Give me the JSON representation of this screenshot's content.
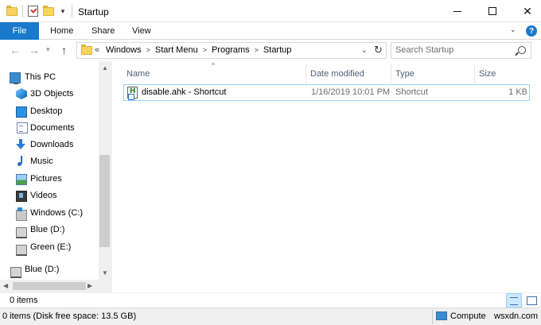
{
  "window": {
    "title": "Startup"
  },
  "ribbon": {
    "tabs": [
      "File",
      "Home",
      "Share",
      "View"
    ]
  },
  "address": {
    "overflow": "«",
    "crumbs": [
      "Windows",
      "Start Menu",
      "Programs",
      "Startup"
    ]
  },
  "search": {
    "placeholder": "Search Startup"
  },
  "sidebar": {
    "items": [
      {
        "label": "This PC",
        "icon": "this-pc-icon"
      },
      {
        "label": "3D Objects",
        "icon": "3d-objects-icon"
      },
      {
        "label": "Desktop",
        "icon": "desktop-icon"
      },
      {
        "label": "Documents",
        "icon": "documents-icon"
      },
      {
        "label": "Downloads",
        "icon": "downloads-icon"
      },
      {
        "label": "Music",
        "icon": "music-icon"
      },
      {
        "label": "Pictures",
        "icon": "pictures-icon"
      },
      {
        "label": "Videos",
        "icon": "videos-icon"
      },
      {
        "label": "Windows (C:)",
        "icon": "windows-drive-icon"
      },
      {
        "label": "Blue (D:)",
        "icon": "drive-icon"
      },
      {
        "label": "Green (E:)",
        "icon": "drive-icon"
      },
      {
        "label": "Blue (D:)",
        "icon": "drive-icon"
      }
    ]
  },
  "columns": {
    "name": "Name",
    "date_modified": "Date modified",
    "type": "Type",
    "size": "Size"
  },
  "files": [
    {
      "name": "disable.ahk - Shortcut",
      "date_modified": "1/16/2019 10:01 PM",
      "type": "Shortcut",
      "size": "1 KB",
      "icon": "ahk-shortcut-icon"
    }
  ],
  "status": {
    "items": "0 items"
  },
  "details": {
    "left": "0 items (Disk free space: 13.5 GB)",
    "right": "Compute",
    "watermark": "wsxdn.com"
  },
  "colors": {
    "accent": "#1979ca",
    "selection_border": "#99d1ff",
    "header_text": "#4c607a"
  }
}
